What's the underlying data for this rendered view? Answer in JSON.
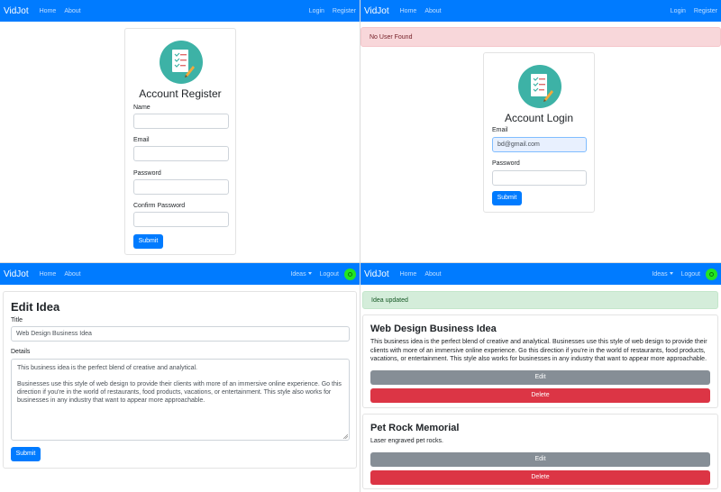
{
  "nav": {
    "brand": "VidJot",
    "home": "Home",
    "about": "About",
    "login": "Login",
    "register": "Register",
    "ideas": "Ideas",
    "logout": "Logout"
  },
  "register": {
    "title": "Account Register",
    "name_label": "Name",
    "email_label": "Email",
    "password_label": "Password",
    "confirm_label": "Confirm Password",
    "submit": "Submit"
  },
  "login": {
    "alert": "No User Found",
    "title": "Account Login",
    "email_label": "Email",
    "email_value": "bd@gmail.com",
    "password_label": "Password",
    "submit": "Submit"
  },
  "edit": {
    "title": "Edit Idea",
    "title_label": "Title",
    "title_value": "Web Design Business Idea",
    "details_label": "Details",
    "details_p1": "This business idea is the perfect blend of creative and analytical.",
    "details_p2": "Businesses use this style of web design to provide their clients with more of an immersive online experience. Go this direction if you're in the world of restaurants, food products, vacations, or entertainment. This style also works for businesses in any industry that want to appear more approachable.",
    "submit": "Submit"
  },
  "ideas_page": {
    "alert": "Idea updated",
    "ideas": [
      {
        "title": "Web Design Business Idea",
        "details": "This business idea is the perfect blend of creative and analytical. Businesses use this style of web design to provide their clients with more of an immersive online experience. Go this direction if you're in the world of restaurants, food products, vacations, or entertainment. This style also works for businesses in any industry that want to appear more approachable.",
        "edit": "Edit",
        "delete": "Delete"
      },
      {
        "title": "Pet Rock Memorial",
        "details": "Laser engraved pet rocks.",
        "edit": "Edit",
        "delete": "Delete"
      }
    ]
  },
  "colors": {
    "primary": "#007bff",
    "secondary": "#868e96",
    "danger": "#dc3545",
    "logo_bg": "#3db2a6",
    "avatar": "#22e522"
  },
  "icons": {
    "logo": "checklist-pencil-icon",
    "avatar": "user-avatar-icon"
  }
}
